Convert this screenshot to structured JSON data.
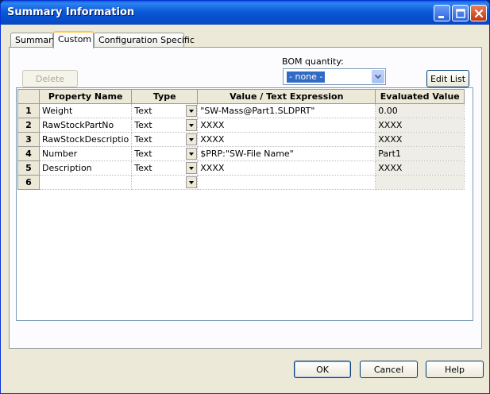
{
  "window": {
    "title": "Summary Information"
  },
  "tabs": [
    {
      "label": "Summary",
      "active": false
    },
    {
      "label": "Custom",
      "active": true
    },
    {
      "label": "Configuration Specific",
      "active": false
    }
  ],
  "toolbar": {
    "delete_label": "Delete",
    "bom_label": "BOM quantity:",
    "bom_value": "- none -",
    "edit_list_label": "Edit List"
  },
  "table": {
    "columns": [
      "",
      "Property Name",
      "Type",
      "Value / Text Expression",
      "Evaluated Value"
    ],
    "rows": [
      {
        "num": "1",
        "name": "Weight",
        "type": "Text",
        "value": "\"SW-Mass@Part1.SLDPRT\"",
        "evaluated": "0.00"
      },
      {
        "num": "2",
        "name": "RawStockPartNo",
        "type": "Text",
        "value": "XXXX",
        "evaluated": "XXXX"
      },
      {
        "num": "3",
        "name": "RawStockDescriptio",
        "type": "Text",
        "value": "XXXX",
        "evaluated": "XXXX"
      },
      {
        "num": "4",
        "name": "Number",
        "type": "Text",
        "value": "$PRP:\"SW-File Name\"",
        "evaluated": "Part1"
      },
      {
        "num": "5",
        "name": "Description",
        "type": "Text",
        "value": "XXXX",
        "evaluated": "XXXX"
      },
      {
        "num": "6",
        "name": "",
        "type": "",
        "value": "",
        "evaluated": ""
      }
    ]
  },
  "buttons": {
    "ok": "OK",
    "cancel": "Cancel",
    "help": "Help"
  },
  "colors": {
    "titlebar": "#0a5fd8",
    "dialog_bg": "#ece9d8",
    "selection": "#316ac5",
    "tab_highlight": "#ffc83c"
  }
}
